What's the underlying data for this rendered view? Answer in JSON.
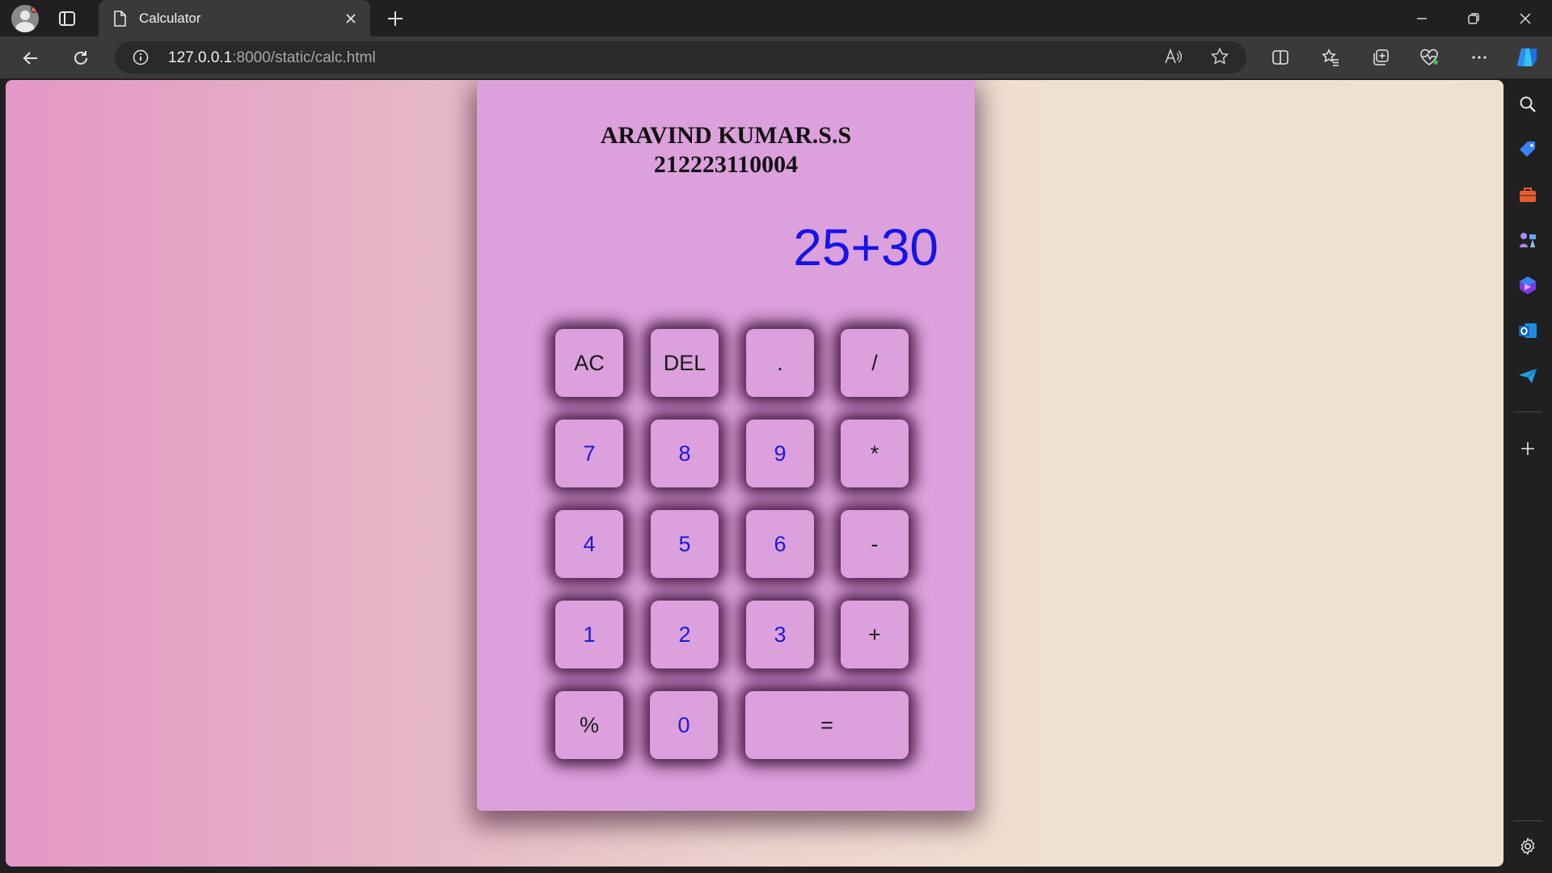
{
  "browser": {
    "tab_title": "Calculator",
    "url_host": "127.0.0.1",
    "url_rest": ":8000/static/calc.html"
  },
  "calculator": {
    "name": "ARAVIND KUMAR.S.S",
    "id": "212223110004",
    "display": "25+30",
    "keys": {
      "ac": "AC",
      "del": "DEL",
      "dot": ".",
      "divide": "/",
      "seven": "7",
      "eight": "8",
      "nine": "9",
      "multiply": "*",
      "four": "4",
      "five": "5",
      "six": "6",
      "minus": "-",
      "one": "1",
      "two": "2",
      "three": "3",
      "plus": "+",
      "percent": "%",
      "zero": "0",
      "equals": "="
    }
  },
  "colors": {
    "calculator_bg": "#dca0dd",
    "display_text": "#1414e6",
    "number_key_text": "#1a1ad6"
  }
}
